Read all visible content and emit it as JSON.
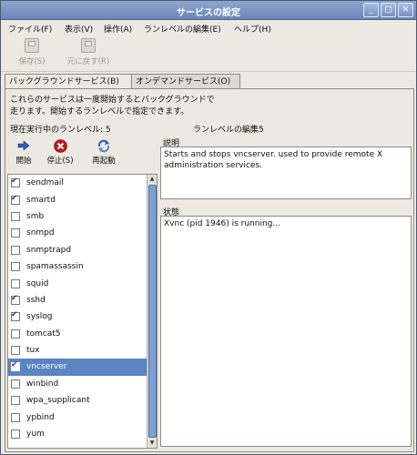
{
  "window": {
    "title": "サービスの設定"
  },
  "menubar": [
    {
      "label": "ファイル(F)"
    },
    {
      "label": "表示(V)"
    },
    {
      "label": "操作(A)"
    },
    {
      "label": "ランレベルの編集(E)"
    },
    {
      "label": "ヘルプ(H)"
    }
  ],
  "toolbar": {
    "save_label": "保存(S)",
    "revert_label": "元に戻す(R)"
  },
  "tabs": [
    {
      "label": "バックグラウンドサービス(B)",
      "active": true
    },
    {
      "label": "オンデマンドサービス(O)",
      "active": false
    }
  ],
  "panel": {
    "description_line1": "これらのサービスは一度開始するとバックグラウンドで",
    "description_line2": "走ります。開始するランレベルで指定できます。",
    "current_runlevel": "現在実行中のランレベル: 5",
    "edit_runlevel": "ランレベルの編集5"
  },
  "actions": {
    "start_label": "開始",
    "stop_label": "停止(S)",
    "restart_label": "再起動"
  },
  "services": [
    {
      "name": "sendmail",
      "enabled": true,
      "selected": false
    },
    {
      "name": "smartd",
      "enabled": true,
      "selected": false
    },
    {
      "name": "smb",
      "enabled": false,
      "selected": false
    },
    {
      "name": "snmpd",
      "enabled": false,
      "selected": false
    },
    {
      "name": "snmptrapd",
      "enabled": false,
      "selected": false
    },
    {
      "name": "spamassassin",
      "enabled": false,
      "selected": false
    },
    {
      "name": "squid",
      "enabled": false,
      "selected": false
    },
    {
      "name": "sshd",
      "enabled": true,
      "selected": false
    },
    {
      "name": "syslog",
      "enabled": true,
      "selected": false
    },
    {
      "name": "tomcat5",
      "enabled": false,
      "selected": false
    },
    {
      "name": "tux",
      "enabled": false,
      "selected": false
    },
    {
      "name": "vncserver",
      "enabled": true,
      "selected": true
    },
    {
      "name": "winbind",
      "enabled": false,
      "selected": false
    },
    {
      "name": "wpa_supplicant",
      "enabled": false,
      "selected": false
    },
    {
      "name": "ypbind",
      "enabled": false,
      "selected": false
    },
    {
      "name": "yum",
      "enabled": false,
      "selected": false
    }
  ],
  "details": {
    "description_label": "説明",
    "description_text": "Starts and stops vncserver. used to provide remote X administration services.",
    "status_label": "状態",
    "status_text": "Xvnc (pid 1946) is running..."
  },
  "colors": {
    "titlebar": "#6a86b9",
    "selection": "#5a84c2",
    "start_arrow": "#2f5fb0",
    "stop_icon": "#c0161b"
  },
  "icons": {
    "save": "save-icon",
    "revert": "revert-icon",
    "start": "right-arrow-icon",
    "stop": "stop-icon",
    "restart": "restart-icon"
  }
}
